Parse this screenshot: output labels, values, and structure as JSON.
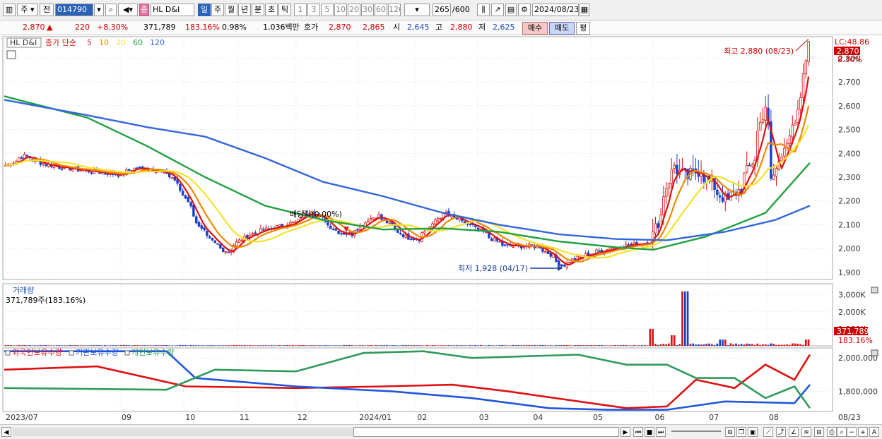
{
  "toolbar": {
    "period_unit": "주",
    "prev_label": "전",
    "stock_code": "014790",
    "stock_name": "HL D&I",
    "stock_badge": "종",
    "intervals": [
      "일",
      "주",
      "월",
      "년",
      "분",
      "초",
      "틱"
    ],
    "selected_interval": "일",
    "minutes": [
      "1",
      "3",
      "5",
      "10",
      "20",
      "30",
      "60",
      "120"
    ],
    "count_display": "265",
    "count_total": "/600",
    "date": "2024/08/23"
  },
  "quote": {
    "price": "2,870",
    "change": "220",
    "change_pct": "+8.30%",
    "volume": "371,789",
    "volume_ratio": "183.16%",
    "turnover_pct": "0.98%",
    "amount": "1,036백만",
    "hoga_label": "호가",
    "ask": "2,870",
    "bid": "2,865",
    "open_label": "시",
    "open": "2,645",
    "high_label": "고",
    "high": "2,880",
    "low_label": "저",
    "low": "2,625",
    "buy_label": "매수",
    "sell_label": "매도",
    "eval_label": "평"
  },
  "price_panel": {
    "legend_name": "HL D&I",
    "legend_ma_title": "종가 단순",
    "ma_periods": [
      "5",
      "10",
      "20",
      "60",
      "120"
    ],
    "ma_colors": [
      "#dd1111",
      "#ee8800",
      "#f4e22a",
      "#22a040",
      "#3366dd"
    ],
    "corner_label": "LC:48.86",
    "last_price_label": "2,870",
    "last_change_label": "8.30%",
    "max_annotation": "최고 2,880 (08/23)",
    "min_annotation": "최저 1,928 (04/17)",
    "dividend_annotation": "배당락(0.00%)",
    "y_ticks": [
      "2,800",
      "2,700",
      "2,600",
      "2,500",
      "2,400",
      "2,300",
      "2,200",
      "2,100",
      "2,000",
      "1,900"
    ]
  },
  "volume_panel": {
    "title": "거래량",
    "info": "371,789주(183.16%)",
    "y_ticks": [
      "3,000K",
      "2,000K",
      "1,000K"
    ],
    "last_label": "371,789",
    "last_pct": "183.16%"
  },
  "holding_panel": {
    "series": [
      {
        "name": "외국인보유수량",
        "color": "#dd1111"
      },
      {
        "name": "기관보유수량",
        "color": "#2255dd"
      },
      {
        "name": "개인보유수량",
        "color": "#2e9a5c"
      }
    ],
    "y_ticks": [
      "2,000,000",
      "1,800,000"
    ]
  },
  "x_axis": {
    "labels": [
      "2023/07",
      "09",
      "10",
      "11",
      "12",
      "2024/01",
      "02",
      "03",
      "04",
      "05",
      "06",
      "07",
      "08"
    ],
    "right_label": "08/23"
  },
  "chart_data": {
    "type": "line",
    "title": "HL D&I",
    "price_ylim": [
      1870,
      2890
    ],
    "volume_ylim": [
      0,
      3400
    ],
    "holding_ylim": [
      1680000,
      2060000
    ],
    "date_range": [
      "2023-07-03",
      "2024-08-23"
    ],
    "dividend_date": "2023-12-27",
    "min_close": {
      "date": "2024-04-17",
      "value": 1928
    },
    "max_high": {
      "date": "2024-08-23",
      "value": 2880
    },
    "close_points": [
      [
        "2023-07-03",
        2350
      ],
      [
        "2023-07-12",
        2390
      ],
      [
        "2023-07-20",
        2360
      ],
      [
        "2023-08-01",
        2340
      ],
      [
        "2023-08-10",
        2330
      ],
      [
        "2023-08-21",
        2320
      ],
      [
        "2023-08-31",
        2310
      ],
      [
        "2023-09-08",
        2340
      ],
      [
        "2023-09-19",
        2330
      ],
      [
        "2023-09-27",
        2300
      ],
      [
        "2023-10-05",
        2200
      ],
      [
        "2023-10-12",
        2080
      ],
      [
        "2023-10-19",
        2020
      ],
      [
        "2023-10-26",
        1985
      ],
      [
        "2023-11-02",
        2040
      ],
      [
        "2023-11-10",
        2070
      ],
      [
        "2023-11-20",
        2090
      ],
      [
        "2023-11-30",
        2110
      ],
      [
        "2023-12-08",
        2160
      ],
      [
        "2023-12-15",
        2120
      ],
      [
        "2023-12-22",
        2070
      ],
      [
        "2023-12-29",
        2060
      ],
      [
        "2024-01-05",
        2110
      ],
      [
        "2024-01-12",
        2140
      ],
      [
        "2024-01-19",
        2100
      ],
      [
        "2024-01-26",
        2050
      ],
      [
        "2024-02-02",
        2040
      ],
      [
        "2024-02-08",
        2090
      ],
      [
        "2024-02-16",
        2150
      ],
      [
        "2024-02-23",
        2120
      ],
      [
        "2024-03-05",
        2080
      ],
      [
        "2024-03-12",
        2040
      ],
      [
        "2024-03-19",
        2010
      ],
      [
        "2024-03-28",
        2010
      ],
      [
        "2024-04-05",
        2010
      ],
      [
        "2024-04-12",
        1970
      ],
      [
        "2024-04-17",
        1928
      ],
      [
        "2024-04-25",
        1960
      ],
      [
        "2024-05-07",
        1990
      ],
      [
        "2024-05-17",
        2010
      ],
      [
        "2024-05-27",
        2020
      ],
      [
        "2024-06-03",
        2030
      ],
      [
        "2024-06-07",
        2140
      ],
      [
        "2024-06-14",
        2350
      ],
      [
        "2024-06-21",
        2300
      ],
      [
        "2024-06-28",
        2330
      ],
      [
        "2024-07-05",
        2260
      ],
      [
        "2024-07-12",
        2200
      ],
      [
        "2024-07-19",
        2250
      ],
      [
        "2024-07-26",
        2380
      ],
      [
        "2024-08-01",
        2600
      ],
      [
        "2024-08-05",
        2280
      ],
      [
        "2024-08-09",
        2390
      ],
      [
        "2024-08-14",
        2480
      ],
      [
        "2024-08-19",
        2560
      ],
      [
        "2024-08-23",
        2870
      ]
    ],
    "ma_points": {
      "60": [
        [
          "2023-07-03",
          2640
        ],
        [
          "2023-08-15",
          2550
        ],
        [
          "2023-09-15",
          2430
        ],
        [
          "2023-10-15",
          2300
        ],
        [
          "2023-11-15",
          2180
        ],
        [
          "2023-12-15",
          2120
        ],
        [
          "2024-01-15",
          2080
        ],
        [
          "2024-02-15",
          2085
        ],
        [
          "2024-03-15",
          2070
        ],
        [
          "2024-04-15",
          2030
        ],
        [
          "2024-05-15",
          2005
        ],
        [
          "2024-06-03",
          1995
        ],
        [
          "2024-06-30",
          2050
        ],
        [
          "2024-07-31",
          2150
        ],
        [
          "2024-08-23",
          2360
        ]
      ],
      "120": [
        [
          "2023-07-03",
          2625
        ],
        [
          "2023-08-15",
          2560
        ],
        [
          "2023-09-15",
          2510
        ],
        [
          "2023-10-15",
          2470
        ],
        [
          "2023-11-15",
          2380
        ],
        [
          "2023-12-15",
          2280
        ],
        [
          "2024-01-15",
          2220
        ],
        [
          "2024-02-15",
          2150
        ],
        [
          "2024-03-15",
          2100
        ],
        [
          "2024-04-15",
          2060
        ],
        [
          "2024-05-15",
          2040
        ],
        [
          "2024-06-10",
          2035
        ],
        [
          "2024-07-10",
          2070
        ],
        [
          "2024-08-05",
          2120
        ],
        [
          "2024-08-23",
          2180
        ]
      ]
    },
    "volume_spikes": [
      [
        "2024-06-03",
        1000
      ],
      [
        "2024-06-14",
        620
      ],
      [
        "2024-06-20",
        3200
      ],
      [
        "2024-07-10",
        370
      ],
      [
        "2024-08-23",
        372
      ]
    ],
    "holdings": {
      "외국인보유수량": [
        [
          "2023-07-03",
          1930000
        ],
        [
          "2023-08-20",
          1950000
        ],
        [
          "2023-10-05",
          1830000
        ],
        [
          "2023-12-01",
          1820000
        ],
        [
          "2024-01-15",
          1830000
        ],
        [
          "2024-02-20",
          1840000
        ],
        [
          "2024-03-20",
          1800000
        ],
        [
          "2024-05-20",
          1700000
        ],
        [
          "2024-06-10",
          1710000
        ],
        [
          "2024-06-25",
          1870000
        ],
        [
          "2024-07-15",
          1820000
        ],
        [
          "2024-07-31",
          1960000
        ],
        [
          "2024-08-15",
          1870000
        ],
        [
          "2024-08-23",
          2020000
        ]
      ],
      "기관보유수량": [
        [
          "2023-07-03",
          2040000
        ],
        [
          "2023-09-25",
          2040000
        ],
        [
          "2023-10-10",
          1880000
        ],
        [
          "2023-12-01",
          1830000
        ],
        [
          "2024-01-20",
          1800000
        ],
        [
          "2024-03-01",
          1760000
        ],
        [
          "2024-04-10",
          1700000
        ],
        [
          "2024-05-10",
          1690000
        ],
        [
          "2024-06-10",
          1690000
        ],
        [
          "2024-07-10",
          1740000
        ],
        [
          "2024-08-15",
          1730000
        ],
        [
          "2024-08-23",
          1840000
        ]
      ],
      "개인보유수량": [
        [
          "2023-07-03",
          1820000
        ],
        [
          "2023-09-25",
          1810000
        ],
        [
          "2023-10-20",
          1930000
        ],
        [
          "2023-12-01",
          1920000
        ],
        [
          "2024-01-05",
          2030000
        ],
        [
          "2024-02-05",
          2040000
        ],
        [
          "2024-03-01",
          2000000
        ],
        [
          "2024-04-25",
          2020000
        ],
        [
          "2024-05-20",
          1960000
        ],
        [
          "2024-06-10",
          1960000
        ],
        [
          "2024-06-25",
          1880000
        ],
        [
          "2024-07-15",
          1880000
        ],
        [
          "2024-07-31",
          1760000
        ],
        [
          "2024-08-15",
          1830000
        ],
        [
          "2024-08-23",
          1700000
        ]
      ]
    }
  }
}
